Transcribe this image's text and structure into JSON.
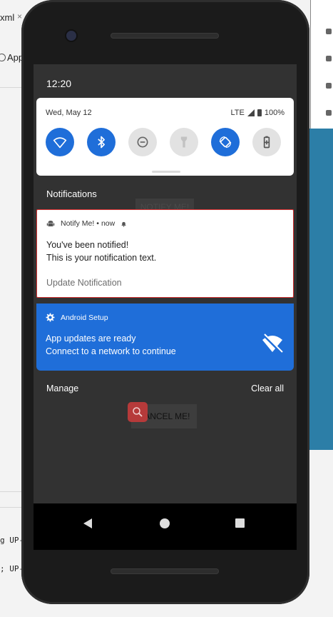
{
  "ide": {
    "tab_fragment": "xml",
    "tab_close": "×",
    "app_fragment": "App",
    "log_line_1": "g UP-",
    "log_line_2": "; UP-1"
  },
  "status_bar": {
    "time": "12:20"
  },
  "quick_settings": {
    "date": "Wed, May 12",
    "network": "LTE",
    "battery": "100%",
    "tiles": [
      {
        "name": "wifi",
        "on": true
      },
      {
        "name": "bluetooth",
        "on": true
      },
      {
        "name": "do-not-disturb",
        "on": false
      },
      {
        "name": "flashlight",
        "on": false
      },
      {
        "name": "auto-rotate",
        "on": true
      },
      {
        "name": "battery-saver",
        "on": false
      }
    ]
  },
  "notifications": {
    "section_title": "Notifications",
    "notify_card": {
      "app_name": "Notify Me!",
      "time": "now",
      "title": "You've been notified!",
      "text": "This is your notification text.",
      "action": "Update Notification",
      "border_color": "#d32f2f"
    },
    "setup_card": {
      "app_name": "Android Setup",
      "title": "App updates are ready",
      "text": "Connect to a network to continue",
      "color": "#1f6ed9"
    },
    "manage_label": "Manage",
    "clear_all_label": "Clear all"
  },
  "background_app": {
    "notify_button": "NOTIFY ME!",
    "cancel_button": "CANCEL ME!"
  },
  "colors": {
    "accent": "#1f6ed9",
    "shade": "#323232"
  }
}
